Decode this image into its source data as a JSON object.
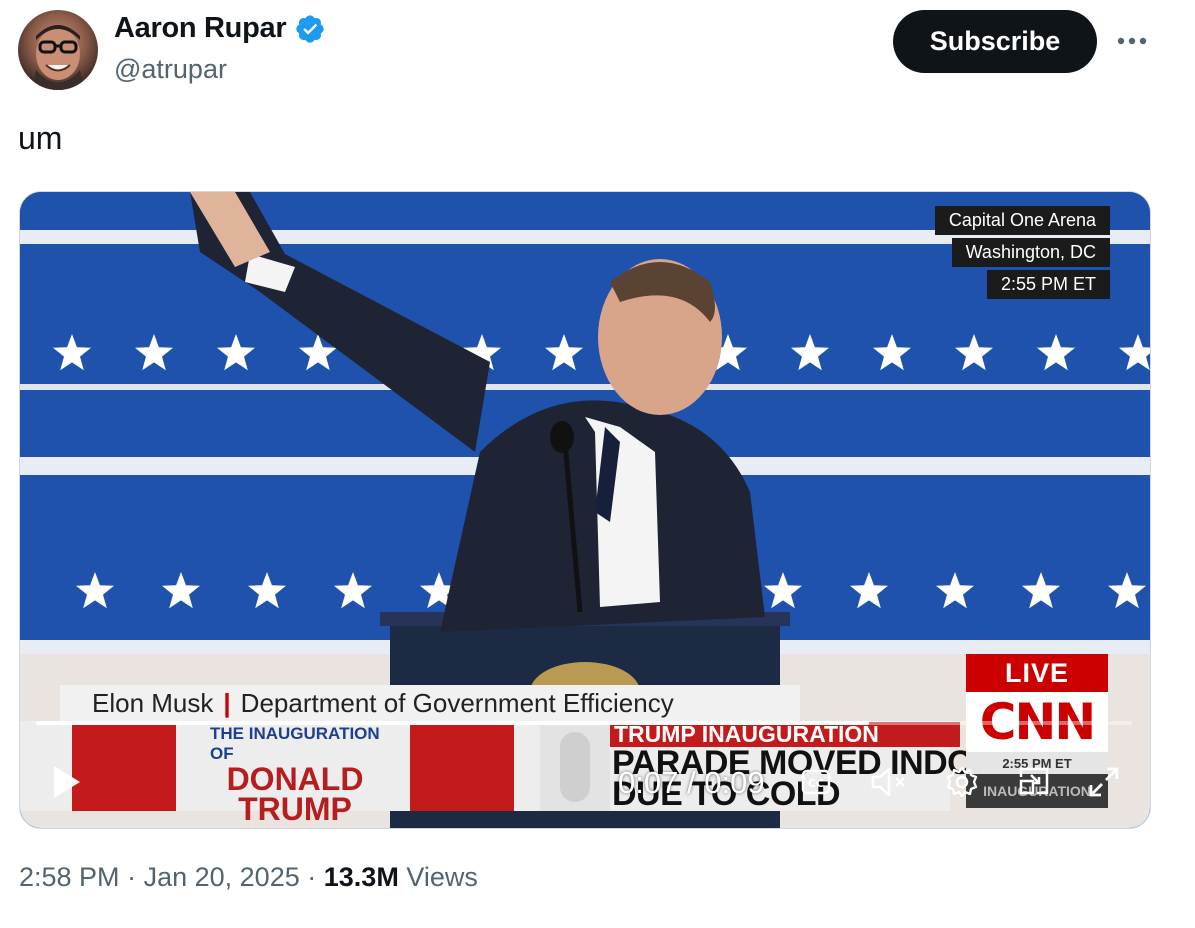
{
  "author": {
    "name": "Aaron Rupar",
    "handle": "@atrupar",
    "verified": true,
    "avatar_icon": "avatar"
  },
  "header": {
    "subscribe_label": "Subscribe",
    "more_icon": "more-horizontal-icon"
  },
  "tweet": {
    "text": "um"
  },
  "video": {
    "location_lines": [
      "Capital One Arena",
      "Washington, DC",
      "2:55 PM ET"
    ],
    "lower_third": {
      "name": "Elon Musk",
      "separator": "|",
      "title": "Department of Government Efficiency"
    },
    "inauguration_logo": {
      "line1": "THE INAUGURATION OF",
      "line2": "DONALD",
      "line3": "TRUMP"
    },
    "headline_kicker": "TRUMP INAUGURATION",
    "headline_line1": "PARADE MOVED INDOORS",
    "headline_line2": "DUE TO COLD",
    "network": {
      "live_label": "LIVE",
      "logo_text": "CNN",
      "time": "2:55 PM ET",
      "inaug_label": "INAUGURATION"
    },
    "player": {
      "current_time": "0:07",
      "separator": "/",
      "duration": "0:09",
      "progress_fraction": 0.76,
      "play_icon": "play-icon",
      "captions_icon": "captions-icon",
      "mute_icon": "muted-speaker-icon",
      "settings_icon": "gear-icon",
      "pip_icon": "picture-in-picture-icon",
      "fullscreen_icon": "fullscreen-icon"
    }
  },
  "meta": {
    "time": "2:58 PM",
    "dot": "·",
    "date": "Jan 20, 2025",
    "views_count": "13.3M",
    "views_label": "Views"
  },
  "colors": {
    "text_primary": "#0f1419",
    "text_secondary": "#536471",
    "subscribe_bg": "#0f1419",
    "verified_blue": "#1d9bf0",
    "cnn_red": "#cc0000"
  }
}
